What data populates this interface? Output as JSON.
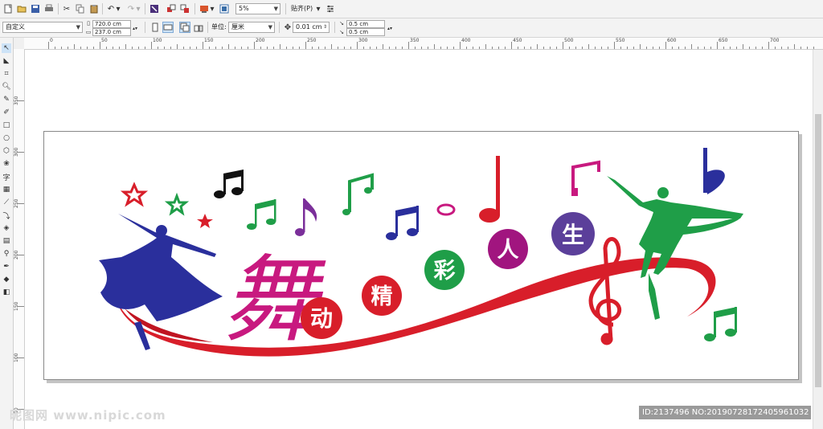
{
  "toolbar": {
    "zoom_value": "5%",
    "snap_label": "贴齐(P)"
  },
  "propbar": {
    "page_preset": "自定义",
    "width_value": "720.0 cm",
    "height_value": "237.0 cm",
    "units_label": "单位:",
    "units_value": "厘米",
    "nudge_value": "0.01 cm",
    "dup_x_value": "0.5 cm",
    "dup_y_value": "0.5 cm"
  },
  "ruler": {
    "h_labels": [
      "0",
      "50",
      "100",
      "150",
      "200",
      "250",
      "300",
      "350",
      "400",
      "450",
      "500",
      "550",
      "600",
      "650",
      "700"
    ],
    "v_labels": [
      "350",
      "300",
      "250",
      "200",
      "150",
      "100",
      "50"
    ]
  },
  "artwork": {
    "calligraphy_char": "舞",
    "circles": [
      {
        "char": "动",
        "color": "#d81e2a"
      },
      {
        "char": "精",
        "color": "#d81e2a"
      },
      {
        "char": "彩",
        "color": "#1f9e48"
      },
      {
        "char": "人",
        "color": "#a1157f"
      },
      {
        "char": "生",
        "color": "#5b3f9a"
      }
    ],
    "colors": {
      "red": "#d81e2a",
      "blue": "#2a2f9c",
      "green": "#1f9e48",
      "magenta": "#c8197f",
      "purple": "#7b2f9a",
      "black": "#111111"
    }
  },
  "watermark": {
    "text": "昵图网 www.nipic.com"
  },
  "image_id": {
    "text": "ID:2137496 NO:20190728172405961032"
  }
}
